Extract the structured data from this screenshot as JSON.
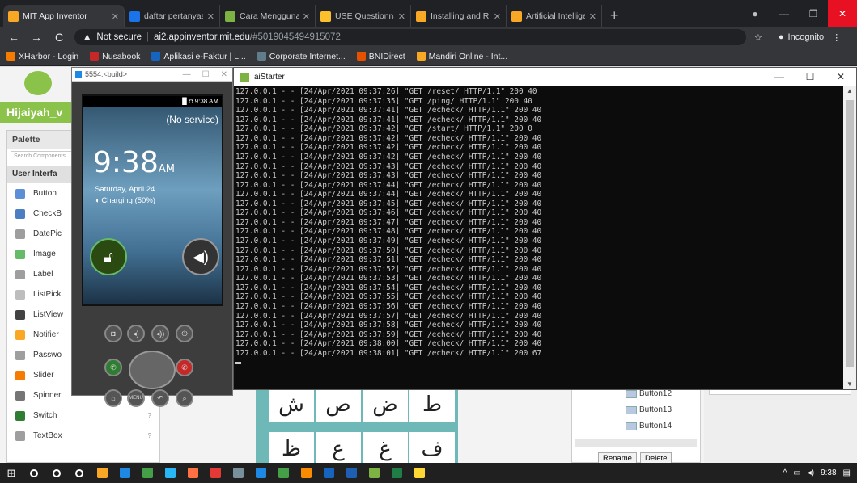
{
  "browser": {
    "tabs": [
      {
        "title": "MIT App Inventor",
        "color": "#f9a825",
        "active": true
      },
      {
        "title": "daftar pertanyaan kue",
        "color": "#1a73e8"
      },
      {
        "title": "Cara Menggunakan S",
        "color": "#7cb342"
      },
      {
        "title": "USE Questionnaire: U",
        "color": "#fbc02d"
      },
      {
        "title": "Installing and Running",
        "color": "#f9a825"
      },
      {
        "title": "Artificial Intelligence",
        "color": "#f9a825"
      }
    ],
    "new_tab": "+",
    "address": {
      "security": "Not secure",
      "host": "ai2.appinventor.mit.edu",
      "path": "/#5019045494915072"
    },
    "profile_label": "Incognito",
    "bookmarks": [
      {
        "label": "XHarbor - Login",
        "color": "#f57c00"
      },
      {
        "label": "Nusabook",
        "color": "#c62828"
      },
      {
        "label": "Aplikasi e-Faktur | L...",
        "color": "#1565c0"
      },
      {
        "label": "Corporate Internet...",
        "color": "#607d8b"
      },
      {
        "label": "BNIDirect",
        "color": "#e65100"
      },
      {
        "label": "Mandiri Online - Int...",
        "color": "#f9a825"
      }
    ]
  },
  "appinventor": {
    "project_name": "Hijaiyah_v",
    "palette_title": "Palette",
    "search_placeholder": "Search Components",
    "category": "User Interfa",
    "items": [
      {
        "label": "Button",
        "color": "#5c8fd6"
      },
      {
        "label": "CheckB",
        "color": "#4a7fc1"
      },
      {
        "label": "DatePic",
        "color": "#9e9e9e"
      },
      {
        "label": "Image",
        "color": "#66bb6a"
      },
      {
        "label": "Label",
        "color": "#9e9e9e"
      },
      {
        "label": "ListPick",
        "color": "#bdbdbd"
      },
      {
        "label": "ListView",
        "color": "#424242"
      },
      {
        "label": "Notifier",
        "color": "#f9a825"
      },
      {
        "label": "Passwo",
        "color": "#9e9e9e"
      },
      {
        "label": "Slider",
        "color": "#f57c00"
      },
      {
        "label": "Spinner",
        "color": "#757575"
      },
      {
        "label": "Switch",
        "color": "#2e7d32"
      },
      {
        "label": "TextBox",
        "color": "#9e9e9e"
      }
    ],
    "help_glyph": "?",
    "arabic_letters": [
      "ش",
      "ص",
      "ض",
      "ط",
      "ظ",
      "ع",
      "غ",
      "ف"
    ],
    "components": [
      "Button12",
      "Button13",
      "Button14"
    ],
    "rename_label": "Rename",
    "delete_label": "Delete"
  },
  "emulator": {
    "window_title": "5554:<build>",
    "status_time": "9:38",
    "status_ampm": "AM",
    "no_service": "(No service)",
    "clock": "9:38",
    "clock_ampm": "AM",
    "date": "Saturday, April 24",
    "charging": "Charging (50%)",
    "menu_label": "MENU"
  },
  "aistarter": {
    "title": "aiStarter",
    "log": [
      "127.0.0.1 - - [24/Apr/2021 09:37:26] \"GET /reset/ HTTP/1.1\" 200 40",
      "127.0.0.1 - - [24/Apr/2021 09:37:35] \"GET /ping/ HTTP/1.1\" 200 40",
      "127.0.0.1 - - [24/Apr/2021 09:37:41] \"GET /echeck/ HTTP/1.1\" 200 40",
      "127.0.0.1 - - [24/Apr/2021 09:37:41] \"GET /echeck/ HTTP/1.1\" 200 40",
      "127.0.0.1 - - [24/Apr/2021 09:37:42] \"GET /start/ HTTP/1.1\" 200 0",
      "127.0.0.1 - - [24/Apr/2021 09:37:42] \"GET /echeck/ HTTP/1.1\" 200 40",
      "127.0.0.1 - - [24/Apr/2021 09:37:42] \"GET /echeck/ HTTP/1.1\" 200 40",
      "127.0.0.1 - - [24/Apr/2021 09:37:42] \"GET /echeck/ HTTP/1.1\" 200 40",
      "127.0.0.1 - - [24/Apr/2021 09:37:43] \"GET /echeck/ HTTP/1.1\" 200 40",
      "127.0.0.1 - - [24/Apr/2021 09:37:43] \"GET /echeck/ HTTP/1.1\" 200 40",
      "127.0.0.1 - - [24/Apr/2021 09:37:44] \"GET /echeck/ HTTP/1.1\" 200 40",
      "127.0.0.1 - - [24/Apr/2021 09:37:44] \"GET /echeck/ HTTP/1.1\" 200 40",
      "127.0.0.1 - - [24/Apr/2021 09:37:45] \"GET /echeck/ HTTP/1.1\" 200 40",
      "127.0.0.1 - - [24/Apr/2021 09:37:46] \"GET /echeck/ HTTP/1.1\" 200 40",
      "127.0.0.1 - - [24/Apr/2021 09:37:47] \"GET /echeck/ HTTP/1.1\" 200 40",
      "127.0.0.1 - - [24/Apr/2021 09:37:48] \"GET /echeck/ HTTP/1.1\" 200 40",
      "127.0.0.1 - - [24/Apr/2021 09:37:49] \"GET /echeck/ HTTP/1.1\" 200 40",
      "127.0.0.1 - - [24/Apr/2021 09:37:50] \"GET /echeck/ HTTP/1.1\" 200 40",
      "127.0.0.1 - - [24/Apr/2021 09:37:51] \"GET /echeck/ HTTP/1.1\" 200 40",
      "127.0.0.1 - - [24/Apr/2021 09:37:52] \"GET /echeck/ HTTP/1.1\" 200 40",
      "127.0.0.1 - - [24/Apr/2021 09:37:53] \"GET /echeck/ HTTP/1.1\" 200 40",
      "127.0.0.1 - - [24/Apr/2021 09:37:54] \"GET /echeck/ HTTP/1.1\" 200 40",
      "127.0.0.1 - - [24/Apr/2021 09:37:55] \"GET /echeck/ HTTP/1.1\" 200 40",
      "127.0.0.1 - - [24/Apr/2021 09:37:56] \"GET /echeck/ HTTP/1.1\" 200 40",
      "127.0.0.1 - - [24/Apr/2021 09:37:57] \"GET /echeck/ HTTP/1.1\" 200 40",
      "127.0.0.1 - - [24/Apr/2021 09:37:58] \"GET /echeck/ HTTP/1.1\" 200 40",
      "127.0.0.1 - - [24/Apr/2021 09:37:59] \"GET /echeck/ HTTP/1.1\" 200 40",
      "127.0.0.1 - - [24/Apr/2021 09:38:00] \"GET /echeck/ HTTP/1.1\" 200 40",
      "127.0.0.1 - - [24/Apr/2021 09:38:01] \"GET /echeck/ HTTP/1.1\" 200 67"
    ]
  },
  "taskbar": {
    "time": "9:38",
    "apps": [
      {
        "name": "search-icon",
        "color": "#ffffff"
      },
      {
        "name": "cortana-icon",
        "color": "#ffffff"
      },
      {
        "name": "task-view-icon",
        "color": "#ffffff"
      },
      {
        "name": "file-explorer-icon",
        "color": "#f9a825"
      },
      {
        "name": "store-icon",
        "color": "#1e88e5"
      },
      {
        "name": "chrome-icon",
        "color": "#43a047"
      },
      {
        "name": "app-icon-1",
        "color": "#29b6f6"
      },
      {
        "name": "firefox-icon",
        "color": "#ff7043"
      },
      {
        "name": "app-icon-2",
        "color": "#e53935"
      },
      {
        "name": "app-icon-3",
        "color": "#78909c"
      },
      {
        "name": "app-icon-4",
        "color": "#1e88e5"
      },
      {
        "name": "whatsapp-icon",
        "color": "#43a047"
      },
      {
        "name": "app-icon-5",
        "color": "#fb8c00"
      },
      {
        "name": "app-icon-6",
        "color": "#1565c0"
      },
      {
        "name": "word-icon",
        "color": "#1e5fb4"
      },
      {
        "name": "aistarter-task-icon",
        "color": "#7cb342"
      },
      {
        "name": "excel-icon",
        "color": "#1e7e45"
      },
      {
        "name": "app-icon-7",
        "color": "#fdd835"
      }
    ]
  }
}
